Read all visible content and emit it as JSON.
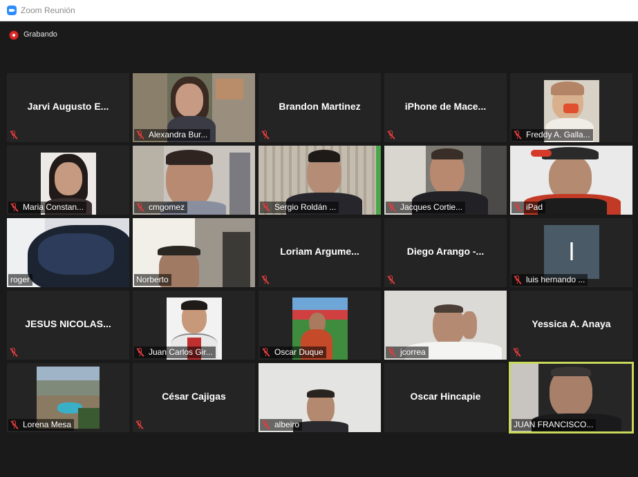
{
  "window": {
    "title": "Zoom Reunión"
  },
  "recording": {
    "label": "Grabando"
  },
  "participants": [
    {
      "name": "Jarvi Augusto E...",
      "video": false
    },
    {
      "name": "Alexandra Bur...",
      "video": true
    },
    {
      "name": "Brandon Martinez",
      "video": false
    },
    {
      "name": "iPhone de Mace...",
      "video": false
    },
    {
      "name": "Freddy A. Galla...",
      "video": true
    },
    {
      "name": "Maria Constan...",
      "video": true
    },
    {
      "name": "cmgomez",
      "video": true
    },
    {
      "name": "Sergio Roldán ...",
      "video": true
    },
    {
      "name": "Jacques Cortie...",
      "video": true
    },
    {
      "name": "iPad",
      "video": true
    },
    {
      "name": "roger",
      "video": true
    },
    {
      "name": "Norberto",
      "video": true
    },
    {
      "name": "Loriam Argume...",
      "video": false
    },
    {
      "name": "Diego Arango -...",
      "video": false
    },
    {
      "name": "luis hernando ...",
      "video": true,
      "avatar_letter": "l"
    },
    {
      "name": "JESUS NICOLAS...",
      "video": false
    },
    {
      "name": "Juan Carlos Gir...",
      "video": true
    },
    {
      "name": "Oscar Duque",
      "video": true
    },
    {
      "name": "jcorrea",
      "video": true
    },
    {
      "name": "Yessica A. Anaya",
      "video": false
    },
    {
      "name": "Lorena Mesa",
      "video": true
    },
    {
      "name": "César Cajigas",
      "video": false
    },
    {
      "name": "albeiro",
      "video": true
    },
    {
      "name": "Oscar Hincapie",
      "video": false
    },
    {
      "name": "JUAN FRANCISCO...",
      "video": true,
      "active_speaker": true
    }
  ],
  "colors": {
    "background": "#1a1a1a",
    "tile": "#242424",
    "active_border": "#c9d95b",
    "muted_icon": "#e23c3c",
    "brand": "#2d8cff"
  }
}
